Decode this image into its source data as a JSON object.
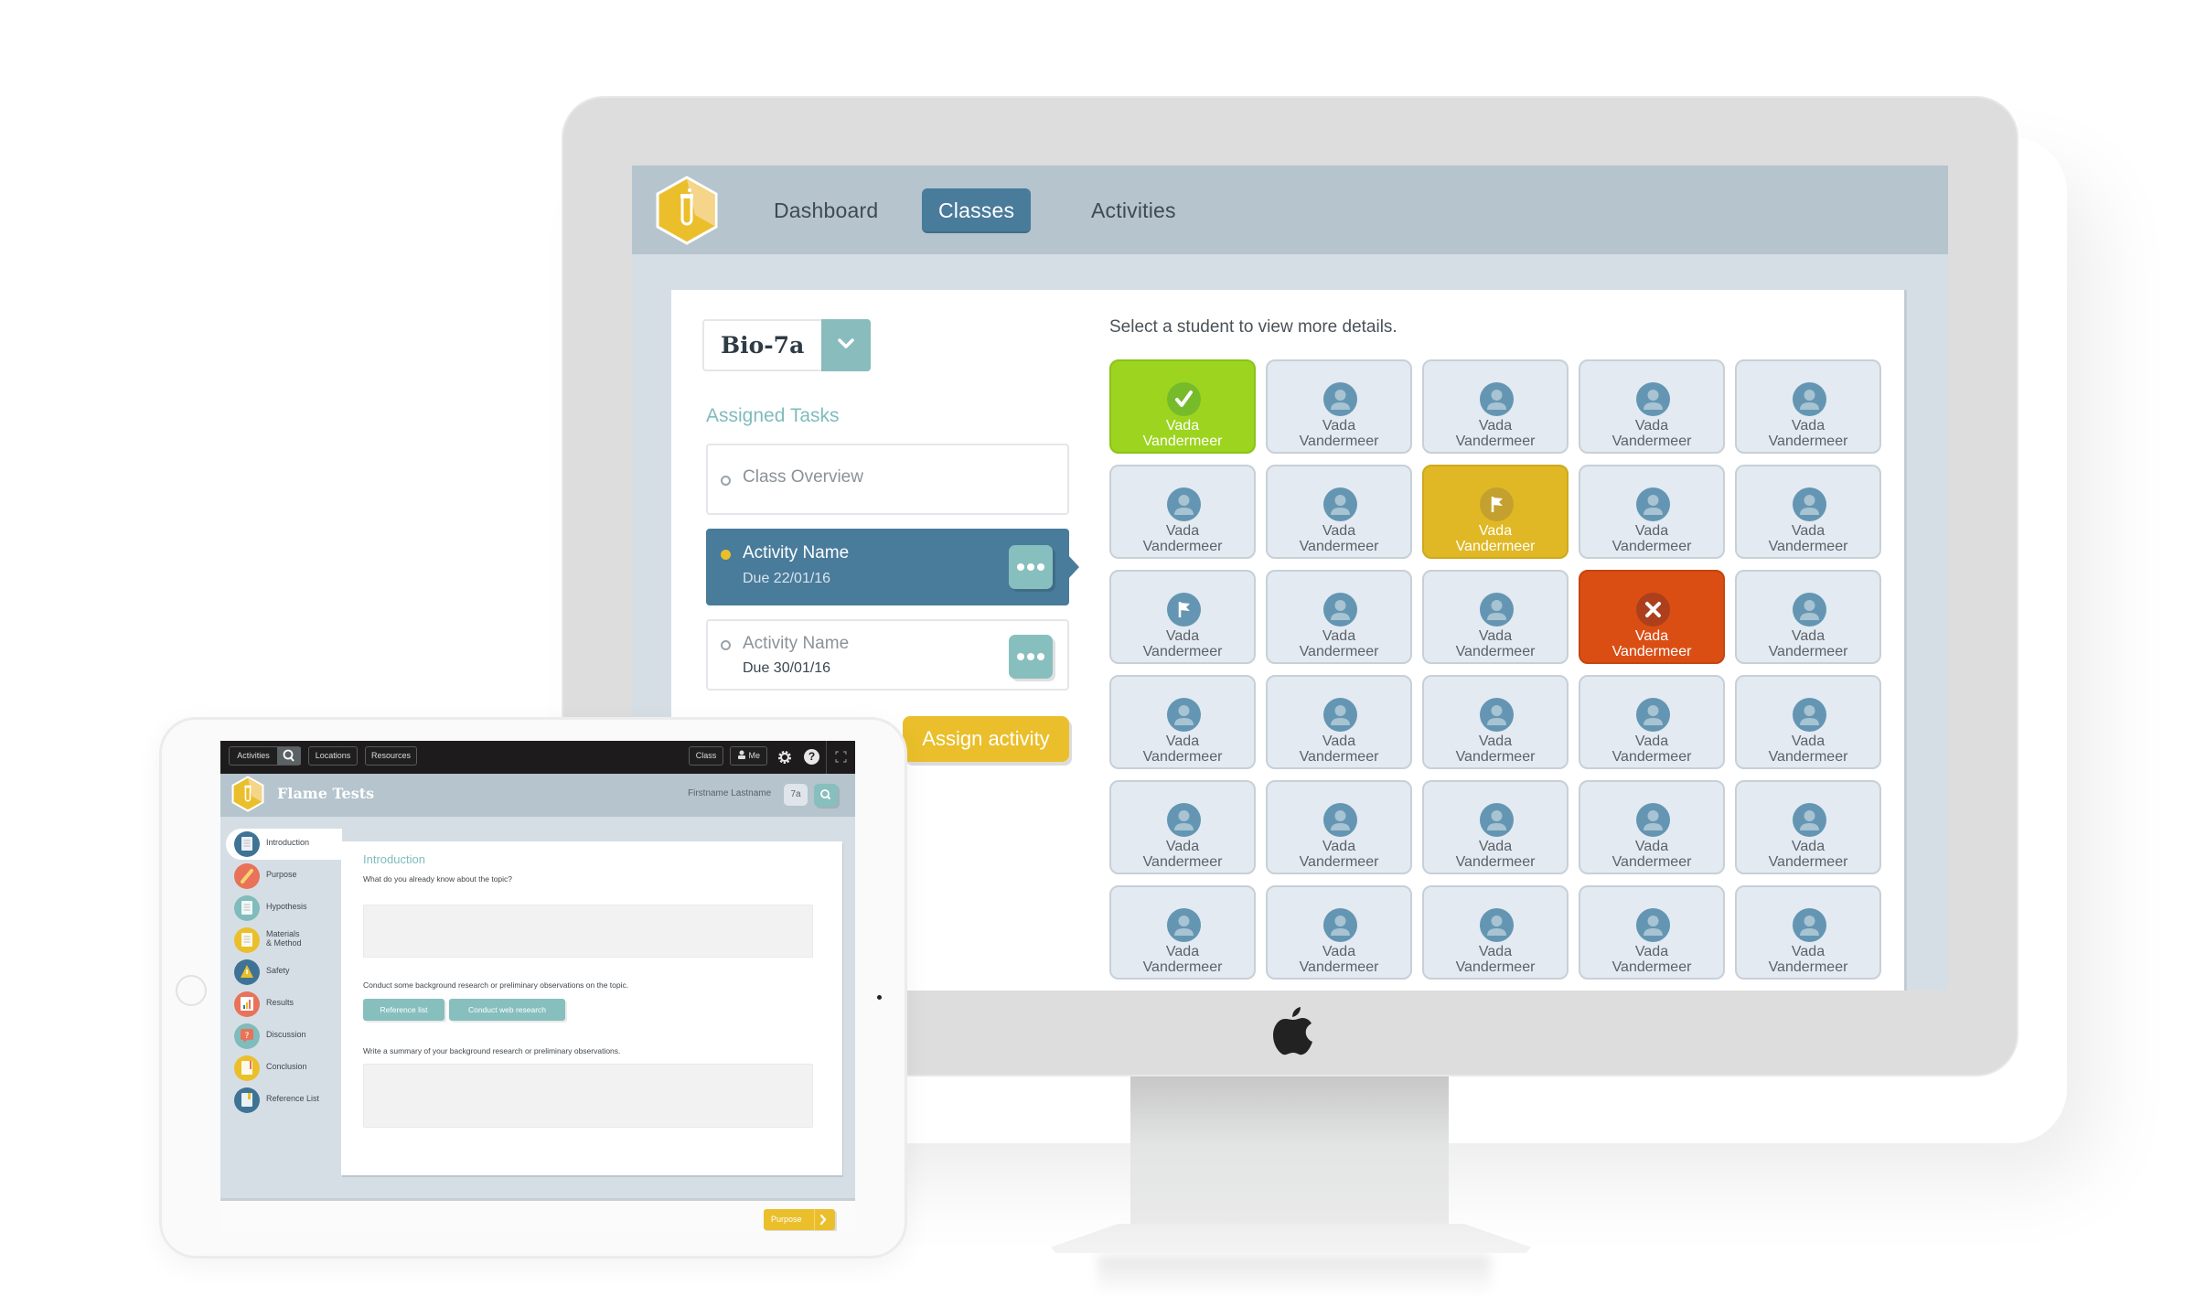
{
  "desktop_app": {
    "nav": {
      "logo": "test-tube-hexagon-logo",
      "items": [
        {
          "label": "Dashboard",
          "active": false
        },
        {
          "label": "Classes",
          "active": true
        },
        {
          "label": "Activities",
          "active": false
        }
      ]
    },
    "class_selector": {
      "value": "Bio-7a",
      "icon": "chevron-down-icon"
    },
    "assigned_tasks": {
      "title": "Assigned Tasks",
      "items": [
        {
          "name": "Class Overview",
          "due": "",
          "active": false
        },
        {
          "name": "Activity Name",
          "due": "Due 22/01/16",
          "active": true
        },
        {
          "name": "Activity Name",
          "due": "Due 30/01/16",
          "active": false
        }
      ],
      "more_icon": "more-dots-icon"
    },
    "assign_button": "Assign activity",
    "students": {
      "hint": "Select a student to view more details.",
      "columns": 5,
      "tiles": [
        {
          "first": "Vada",
          "last": "Vandermeer",
          "status": "done"
        },
        {
          "first": "Vada",
          "last": "Vandermeer",
          "status": "none"
        },
        {
          "first": "Vada",
          "last": "Vandermeer",
          "status": "none"
        },
        {
          "first": "Vada",
          "last": "Vandermeer",
          "status": "none"
        },
        {
          "first": "Vada",
          "last": "Vandermeer",
          "status": "none"
        },
        {
          "first": "Vada",
          "last": "Vandermeer",
          "status": "none"
        },
        {
          "first": "Vada",
          "last": "Vandermeer",
          "status": "none"
        },
        {
          "first": "Vada",
          "last": "Vandermeer",
          "status": "flagged"
        },
        {
          "first": "Vada",
          "last": "Vandermeer",
          "status": "none"
        },
        {
          "first": "Vada",
          "last": "Vandermeer",
          "status": "none"
        },
        {
          "first": "Vada",
          "last": "Vandermeer",
          "status": "help"
        },
        {
          "first": "Vada",
          "last": "Vandermeer",
          "status": "none"
        },
        {
          "first": "Vada",
          "last": "Vandermeer",
          "status": "none"
        },
        {
          "first": "Vada",
          "last": "Vandermeer",
          "status": "failed"
        },
        {
          "first": "Vada",
          "last": "Vandermeer",
          "status": "none"
        },
        {
          "first": "Vada",
          "last": "Vandermeer",
          "status": "none"
        },
        {
          "first": "Vada",
          "last": "Vandermeer",
          "status": "none"
        },
        {
          "first": "Vada",
          "last": "Vandermeer",
          "status": "none"
        },
        {
          "first": "Vada",
          "last": "Vandermeer",
          "status": "none"
        },
        {
          "first": "Vada",
          "last": "Vandermeer",
          "status": "none"
        },
        {
          "first": "Vada",
          "last": "Vandermeer",
          "status": "none"
        },
        {
          "first": "Vada",
          "last": "Vandermeer",
          "status": "none"
        },
        {
          "first": "Vada",
          "last": "Vandermeer",
          "status": "none"
        },
        {
          "first": "Vada",
          "last": "Vandermeer",
          "status": "none"
        },
        {
          "first": "Vada",
          "last": "Vandermeer",
          "status": "none"
        },
        {
          "first": "Vada",
          "last": "Vandermeer",
          "status": "none"
        },
        {
          "first": "Vada",
          "last": "Vandermeer",
          "status": "none"
        },
        {
          "first": "Vada",
          "last": "Vandermeer",
          "status": "none"
        },
        {
          "first": "Vada",
          "last": "Vandermeer",
          "status": "none"
        },
        {
          "first": "Vada",
          "last": "Vandermeer",
          "status": "none"
        }
      ]
    },
    "colors": {
      "accent_blue": "#497b9b",
      "teal": "#87bfbe",
      "yellow": "#eabf2b",
      "status_done": "#9cd41f",
      "status_flagged": "#e0b825",
      "status_failed": "#da4e14"
    }
  },
  "tablet_app": {
    "topbar": {
      "activities": "Activities",
      "locations": "Locations",
      "resources": "Resources",
      "class": "Class",
      "me": "Me"
    },
    "header": {
      "title": "Flame Tests",
      "user": "Firstname Lastname",
      "class_badge": "7a"
    },
    "sections": [
      {
        "label": "Introduction",
        "icon": "document-icon",
        "color": "#3f7396",
        "active": true
      },
      {
        "label": "Purpose",
        "icon": "pencil-icon",
        "color": "#e8735a",
        "active": false
      },
      {
        "label": "Hypothesis",
        "icon": "document-icon",
        "color": "#7fbcbb",
        "active": false
      },
      {
        "label": "Materials\n& Method",
        "icon": "document-icon",
        "color": "#eabf2b",
        "active": false
      },
      {
        "label": "Safety",
        "icon": "warning-icon",
        "color": "#3f7396",
        "active": false
      },
      {
        "label": "Results",
        "icon": "bar-chart-icon",
        "color": "#e8735a",
        "active": false
      },
      {
        "label": "Discussion",
        "icon": "question-bubble-icon",
        "color": "#7fbcbb",
        "active": false
      },
      {
        "label": "Conclusion",
        "icon": "document-pen-icon",
        "color": "#eabf2b",
        "active": false
      },
      {
        "label": "Reference List",
        "icon": "bookmark-doc-icon",
        "color": "#3f7396",
        "active": false
      }
    ],
    "content": {
      "heading": "Introduction",
      "q1": "What do you already know about the topic?",
      "a1": "",
      "q2": "Conduct some background research or preliminary observations on the topic.",
      "btn_reference": "Reference list",
      "btn_web": "Conduct web research",
      "q3": "Write a summary of your background research or preliminary observations.",
      "a3": ""
    },
    "footer": {
      "next_label": "Purpose"
    }
  }
}
